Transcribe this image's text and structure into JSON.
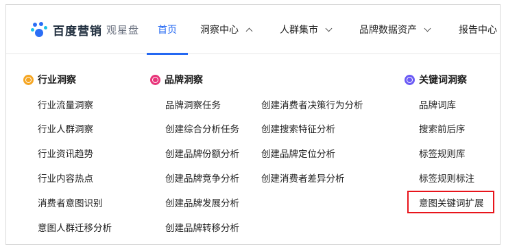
{
  "logo": {
    "brand": "百度营销",
    "product": "观星盘"
  },
  "nav": [
    {
      "label": "首页",
      "active": true,
      "chevron": "none"
    },
    {
      "label": "洞察中心",
      "active": false,
      "chevron": "up"
    },
    {
      "label": "人群集市",
      "active": false,
      "chevron": "down"
    },
    {
      "label": "品牌数据资产",
      "active": false,
      "chevron": "down"
    },
    {
      "label": "报告中心",
      "active": false,
      "chevron": "none"
    }
  ],
  "menu": {
    "industry": {
      "title": "行业洞察",
      "icon": "orange-circle-icon",
      "items": [
        "行业流量洞察",
        "行业人群洞察",
        "行业资讯趋势",
        "行业内容热点",
        "消费者意图识别",
        "意图人群迁移分析"
      ]
    },
    "brand": {
      "title": "品牌洞察",
      "icon": "pink-circle-icon",
      "col1": [
        "品牌洞察任务",
        "创建综合分析任务",
        "创建品牌份额分析",
        "创建品牌竞争分析",
        "创建品牌发展分析",
        "创建品牌转移分析"
      ],
      "col2": [
        "创建消费者决策行为分析",
        "创建搜索特征分析",
        "创建品牌定位分析",
        "创建消费者差异分析"
      ]
    },
    "keyword": {
      "title": "关键词洞察",
      "icon": "purple-circle-icon",
      "items": [
        "品牌词库",
        "搜索前后序",
        "标签规则库",
        "标签规则标注",
        "意图关键词扩展"
      ]
    }
  },
  "colors": {
    "accent": "#2468f2",
    "industry_icon": "#f5a623",
    "brand_icon": "#e8357a",
    "keyword_icon": "#6b5bf5",
    "highlight": "#e8141b"
  }
}
